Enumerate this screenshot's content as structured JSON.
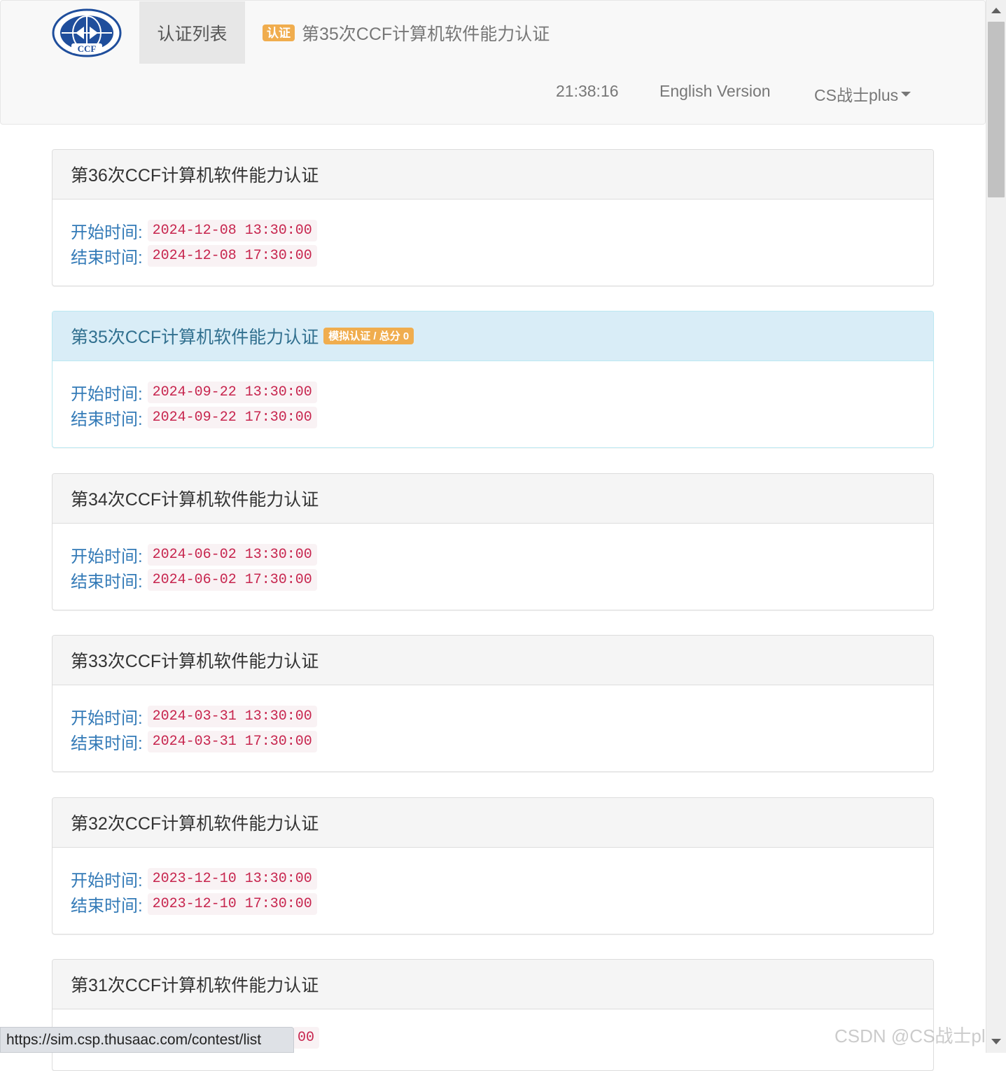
{
  "navbar": {
    "nav_tab": "认证列表",
    "brand_badge": "认证",
    "brand_title": "第35次CCF计算机软件能力认证",
    "time": "21:38:16",
    "english": "English Version",
    "user": "CS战士plus"
  },
  "labels": {
    "start": "开始时间:",
    "end": "结束时间:"
  },
  "contests": [
    {
      "title": "第36次CCF计算机软件能力认证",
      "start": "2024-12-08 13:30:00",
      "end": "2024-12-08 17:30:00"
    },
    {
      "title": "第35次CCF计算机软件能力认证",
      "badge": "模拟认证 / 总分 0",
      "start": "2024-09-22 13:30:00",
      "end": "2024-09-22 17:30:00"
    },
    {
      "title": "第34次CCF计算机软件能力认证",
      "start": "2024-06-02 13:30:00",
      "end": "2024-06-02 17:30:00"
    },
    {
      "title": "第33次CCF计算机软件能力认证",
      "start": "2024-03-31 13:30:00",
      "end": "2024-03-31 17:30:00"
    },
    {
      "title": "第32次CCF计算机软件能力认证",
      "start": "2023-12-10 13:30:00",
      "end": "2023-12-10 17:30:00"
    },
    {
      "title": "第31次CCF计算机软件能力认证",
      "partial_value": "00"
    }
  ],
  "status_bar": "https://sim.csp.thusaac.com/contest/list",
  "watermark": "CSDN @CS战士plus",
  "colors": {
    "warning": "#f0ad4e",
    "link": "#337ab7",
    "code_text": "#c7254e",
    "code_bg": "#f9f2f4",
    "info_heading": "#d9edf7"
  }
}
